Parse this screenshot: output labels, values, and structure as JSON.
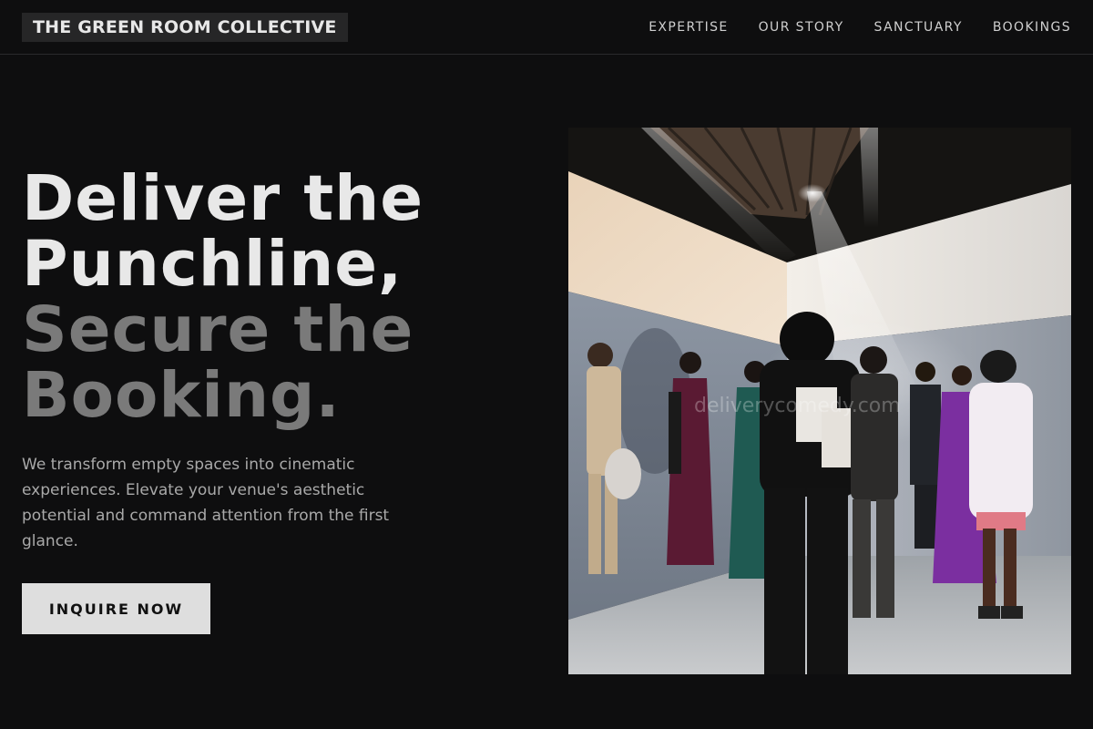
{
  "header": {
    "brand": "THE GREEN ROOM COLLECTIVE",
    "nav": [
      {
        "label": "EXPERTISE"
      },
      {
        "label": "OUR STORY"
      },
      {
        "label": "SANCTUARY"
      },
      {
        "label": "BOOKINGS"
      }
    ]
  },
  "hero": {
    "title_lines": [
      "Deliver the",
      "Punchline,",
      "Secure the",
      "Booking."
    ],
    "subtitle": "We transform empty spaces into cinematic experiences. Elevate your venue's aesthetic potential and command attention from the first glance.",
    "cta_label": "INQUIRE NOW",
    "image": {
      "watermark": "deliverycomedy.com"
    }
  },
  "colors": {
    "background": "#0e0e0f",
    "title_light": "#e8e8e8",
    "title_muted": "#7a7a7a",
    "cta_bg": "#dedede"
  }
}
